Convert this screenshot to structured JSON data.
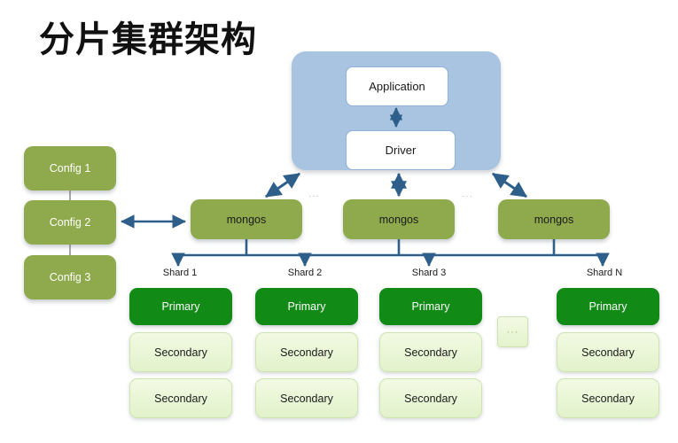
{
  "title": "分片集群架构",
  "colors": {
    "panel_blue": "#a8c4e0",
    "olive": "#8faa4d",
    "primary_green": "#128a16",
    "secondary_green": "#e8f4d4",
    "arrow_blue": "#2e5f8a",
    "title_black": "#111111"
  },
  "client": {
    "application_label": "Application",
    "driver_label": "Driver"
  },
  "config_servers": [
    {
      "label": "Config 1"
    },
    {
      "label": "Config  2"
    },
    {
      "label": "Config 3"
    }
  ],
  "routers": [
    {
      "label": "mongos"
    },
    {
      "label": "mongos"
    },
    {
      "label": "mongos"
    }
  ],
  "router_ellipsis": [
    {
      "label": "···"
    },
    {
      "label": "···"
    }
  ],
  "shards": [
    {
      "caption": "Shard 1",
      "primary": "Primary",
      "secondaries": [
        "Secondary",
        "Secondary"
      ]
    },
    {
      "caption": "Shard 2",
      "primary": "Primary",
      "secondaries": [
        "Secondary",
        "Secondary"
      ]
    },
    {
      "caption": "Shard 3",
      "primary": "Primary",
      "secondaries": [
        "Secondary",
        "Secondary"
      ]
    },
    {
      "caption": "Shard N",
      "primary": "Primary",
      "secondaries": [
        "Secondary",
        "Secondary"
      ]
    }
  ],
  "shard_ellipsis": {
    "label": "···"
  }
}
